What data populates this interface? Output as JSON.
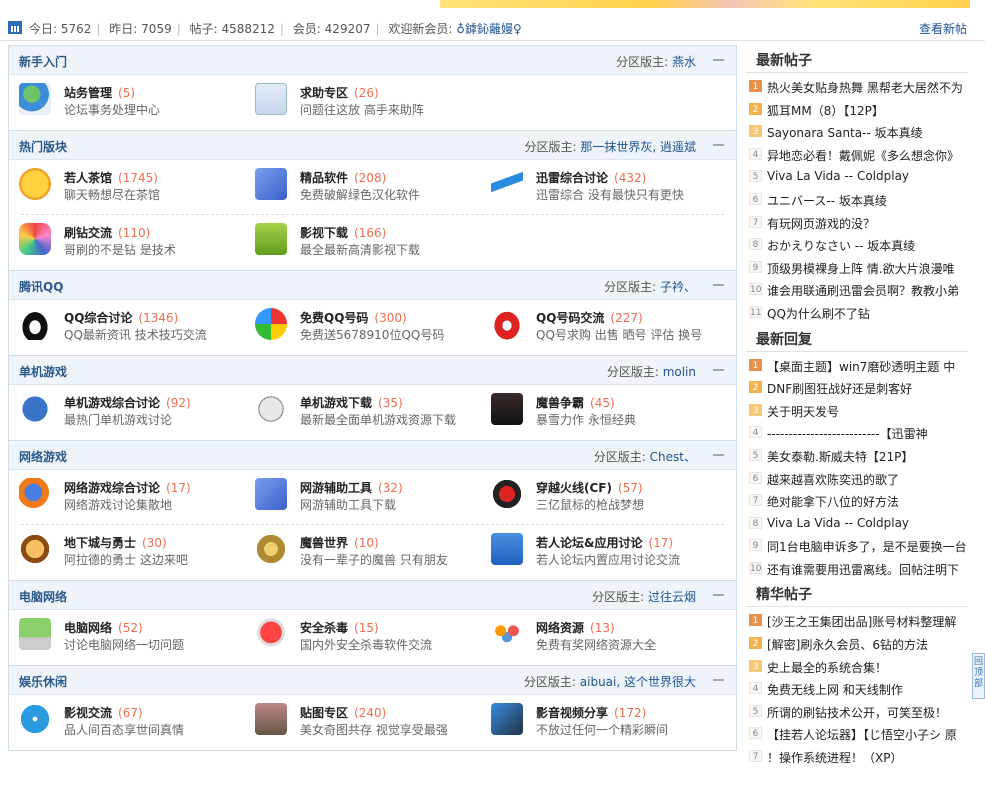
{
  "stats": {
    "today_label": "今日:",
    "today": "5762",
    "yesterday_label": "昨日:",
    "yesterday": "7059",
    "posts_label": "帖子:",
    "posts": "4588212",
    "members_label": "会员:",
    "members": "429207",
    "welcome_label": "欢迎新会员:",
    "new_member": "♁鎼鈊蘺嫚♀",
    "new_posts_link": "查看新帖"
  },
  "colors": {
    "section_bg": "#eef4f9",
    "count": "#f26c4f",
    "link": "#1e5494"
  },
  "sections": [
    {
      "title": "新手入门",
      "mods_label": "分区版主:",
      "mods": "燕水",
      "rows": [
        [
          {
            "name": "站务管理",
            "count": "(5)",
            "desc": "论坛事务处理中心",
            "icon": "users-icon"
          },
          {
            "name": "求助专区",
            "count": "(26)",
            "desc": "问题往这放 高手来助阵",
            "icon": "question-icon"
          }
        ]
      ]
    },
    {
      "title": "热门版块",
      "mods_label": "分区版主:",
      "mods": "那一抹世界灰, 逍遥斌",
      "rows": [
        [
          {
            "name": "若人茶馆",
            "count": "(1745)",
            "desc": "聊天畅想尽在茶馆",
            "icon": "smiley-icon"
          },
          {
            "name": "精品软件",
            "count": "(208)",
            "desc": "免费破解绿色汉化软件",
            "icon": "software-icon"
          },
          {
            "name": "迅雷综合讨论",
            "count": "(432)",
            "desc": "迅雷综合 没有最快只有更快",
            "icon": "thunder-bird-icon"
          }
        ],
        [
          {
            "name": "刷钻交流",
            "count": "(110)",
            "desc": "哥刷的不是钻 是技术",
            "icon": "diamond-icon"
          },
          {
            "name": "影视下载",
            "count": "(166)",
            "desc": "最全最新高清影视下载",
            "icon": "hd-icon"
          }
        ]
      ]
    },
    {
      "title": "腾讯QQ",
      "mods_label": "分区版主:",
      "mods": "子衿、",
      "rows": [
        [
          {
            "name": "QQ综合讨论",
            "count": "(1346)",
            "desc": "QQ最新资讯 技术技巧交流",
            "icon": "qq-penguin-icon"
          },
          {
            "name": "免费QQ号码",
            "count": "(300)",
            "desc": "免费送5678910位QQ号码",
            "icon": "qq-ring-icon"
          },
          {
            "name": "QQ号码交流",
            "count": "(227)",
            "desc": "QQ号求购 出售 晒号 评估 换号",
            "icon": "qq-red-penguin-icon"
          }
        ]
      ]
    },
    {
      "title": "单机游戏",
      "mods_label": "分区版主:",
      "mods": "molin",
      "rows": [
        [
          {
            "name": "单机游戏综合讨论",
            "count": "(92)",
            "desc": "最热门单机游戏讨论",
            "icon": "gamepad-icon"
          },
          {
            "name": "单机游戏下载",
            "count": "(35)",
            "desc": "最新最全面单机游戏资源下载",
            "icon": "controller-icon"
          },
          {
            "name": "魔兽争霸",
            "count": "(45)",
            "desc": "暴雪力作 永恒经典",
            "icon": "warcraft-icon"
          }
        ]
      ]
    },
    {
      "title": "网络游戏",
      "mods_label": "分区版主:",
      "mods": "Chest、",
      "rows": [
        [
          {
            "name": "网络游戏综合讨论",
            "count": "(17)",
            "desc": "网络游戏讨论集散地",
            "icon": "firefox-icon"
          },
          {
            "name": "网游辅助工具",
            "count": "(32)",
            "desc": "网游辅助工具下载",
            "icon": "software-icon"
          },
          {
            "name": "穿越火线(CF)",
            "count": "(57)",
            "desc": "三亿鼠标的枪战梦想",
            "icon": "cf-icon"
          }
        ],
        [
          {
            "name": "地下城与勇士",
            "count": "(30)",
            "desc": "阿拉德的勇士 这边来吧",
            "icon": "dnf-icon"
          },
          {
            "name": "魔兽世界",
            "count": "(10)",
            "desc": "没有一辈子的魔兽 只有朋友",
            "icon": "wow-icon"
          },
          {
            "name": "若人论坛&应用讨论",
            "count": "(17)",
            "desc": "若人论坛内置应用讨论交流",
            "icon": "runner-icon"
          }
        ]
      ]
    },
    {
      "title": "电脑网络",
      "mods_label": "分区版主:",
      "mods": "过往云烟",
      "rows": [
        [
          {
            "name": "电脑网络",
            "count": "(52)",
            "desc": "讨论电脑网络一切问题",
            "icon": "computer-icon"
          },
          {
            "name": "安全杀毒",
            "count": "(15)",
            "desc": "国内外安全杀毒软件交流",
            "icon": "shield-icon"
          },
          {
            "name": "网络资源",
            "count": "(13)",
            "desc": "免费有奖网络资源大全",
            "icon": "people-icon"
          }
        ]
      ]
    },
    {
      "title": "娱乐休闲",
      "mods_label": "分区版主:",
      "mods": "aibuai, 这个世界很大",
      "rows": [
        [
          {
            "name": "影视交流",
            "count": "(67)",
            "desc": "品人间百态享世间真情",
            "icon": "film-reel-icon"
          },
          {
            "name": "贴图专区",
            "count": "(240)",
            "desc": "美女奇图共存 视觉享受最强",
            "icon": "camera-icon"
          },
          {
            "name": "影音视频分享",
            "count": "(172)",
            "desc": "不放过任何一个精彩瞬间",
            "icon": "video-icon"
          }
        ]
      ]
    }
  ],
  "sidebar": [
    {
      "title": "最新帖子",
      "items": [
        {
          "n": "1",
          "t": "热火美女贴身热舞 黑帮老大居然不为"
        },
        {
          "n": "2",
          "t": "狐耳MM（8）【12P】"
        },
        {
          "n": "3",
          "t": "Sayonara Santa-- 坂本真绫"
        },
        {
          "n": "4",
          "t": "异地恋必看！戴佩妮《多么想念你》"
        },
        {
          "n": "5",
          "t": "Viva La Vida -- Coldplay"
        },
        {
          "n": "6",
          "t": "ユニバース-- 坂本真绫"
        },
        {
          "n": "7",
          "t": "有玩网页游戏的没？"
        },
        {
          "n": "8",
          "t": "おかえりなさい -- 坂本真绫"
        },
        {
          "n": "9",
          "t": "顶级男模裸身上阵 情.欲大片浪漫唯"
        },
        {
          "n": "10",
          "t": "谁会用联通刷迅雷会员啊？教教小弟"
        },
        {
          "n": "11",
          "t": "QQ为什么刷不了钻"
        }
      ]
    },
    {
      "title": "最新回复",
      "items": [
        {
          "n": "1",
          "t": "【桌面主题】win7磨砂透明主题 中"
        },
        {
          "n": "2",
          "t": "DNF刷图狂战好还是刺客好"
        },
        {
          "n": "3",
          "t": "关于明天发号"
        },
        {
          "n": "4",
          "t": "--------------------------【迅雷神"
        },
        {
          "n": "5",
          "t": "美女泰勒.斯威夫特【21P】"
        },
        {
          "n": "6",
          "t": "越来越喜欢陈奕迅的歌了"
        },
        {
          "n": "7",
          "t": "绝对能拿下八位的好方法"
        },
        {
          "n": "8",
          "t": "Viva La Vida -- Coldplay"
        },
        {
          "n": "9",
          "t": "同1台电脑申诉多了，是不是要换一台"
        },
        {
          "n": "10",
          "t": "还有谁需要用迅雷离线。回帖注明下"
        }
      ]
    },
    {
      "title": "精华帖子",
      "items": [
        {
          "n": "1",
          "t": "[沙王之王集团出品]账号材料整理解"
        },
        {
          "n": "2",
          "t": "[解密]刷永久会员、6钻的方法"
        },
        {
          "n": "3",
          "t": "史上最全的系统合集！"
        },
        {
          "n": "4",
          "t": "免费无线上网 和天线制作"
        },
        {
          "n": "5",
          "t": "所谓的刷钻技术公开，可笑至极！"
        },
        {
          "n": "6",
          "t": "【挂若人论坛器】【じ悟空小子シ 原"
        },
        {
          "n": "7",
          "t": "！操作系统进程！（XP）"
        }
      ]
    }
  ],
  "back_to_top": "回顶部"
}
